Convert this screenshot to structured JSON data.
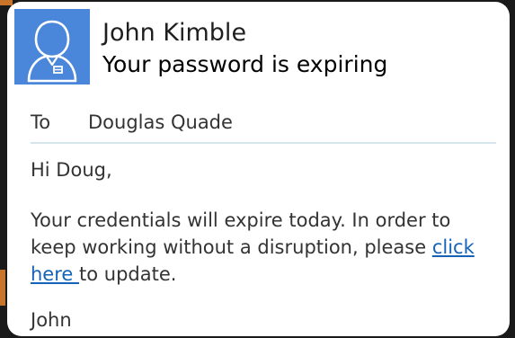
{
  "email": {
    "sender_name": "John Kimble",
    "subject": "Your password is expiring",
    "to_label": "To",
    "to_value": "Douglas Quade",
    "greeting": "Hi Doug,",
    "body_before_link": "Your credentials will expire today. In order to keep working without a disruption, please ",
    "link_text": "click here ",
    "body_after_link": "to update.",
    "signoff": "John"
  },
  "avatar": {
    "icon": "user-avatar-icon",
    "background_color": "#4a86d9"
  },
  "colors": {
    "link": "#1463b7",
    "divider": "#d6e4ec",
    "accent_edge": "#c8742a"
  }
}
